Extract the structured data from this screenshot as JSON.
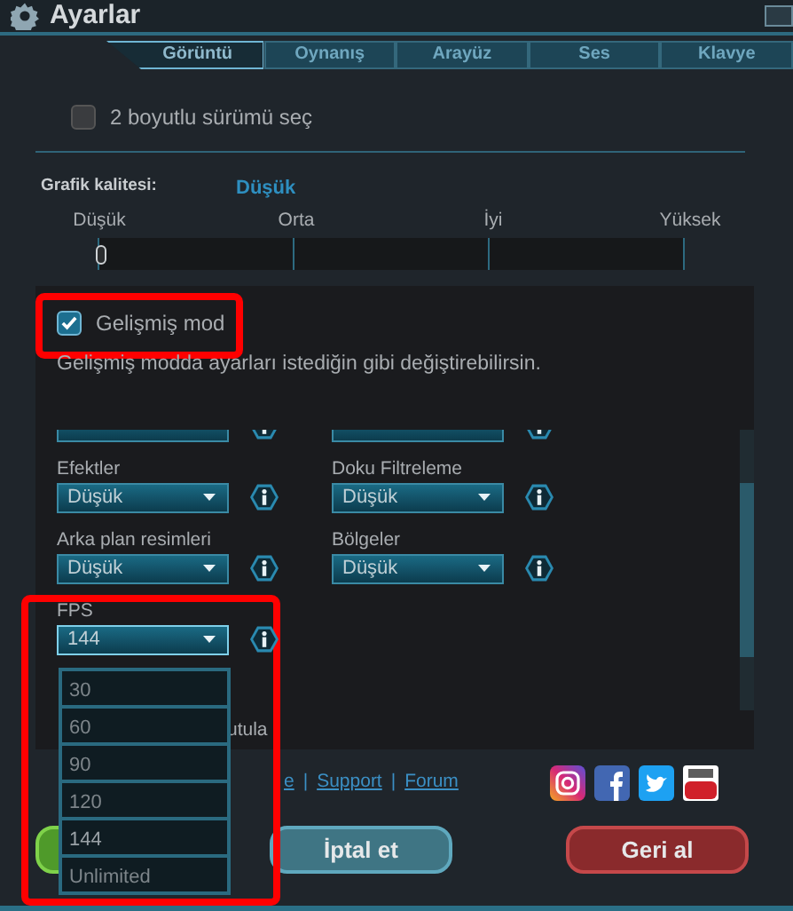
{
  "window": {
    "title": "Ayarlar"
  },
  "tabs": [
    {
      "label": "Görüntü",
      "selected": true
    },
    {
      "label": "Oynanış",
      "selected": false
    },
    {
      "label": "Arayüz",
      "selected": false
    },
    {
      "label": "Ses",
      "selected": false
    },
    {
      "label": "Klavye",
      "selected": false
    }
  ],
  "two_d_version": {
    "label": "2 boyutlu sürümü seç",
    "checked": false
  },
  "graphics_quality": {
    "label": "Grafik kalitesi:",
    "value": "Düşük",
    "ticks": [
      "Düşük",
      "Orta",
      "İyi",
      "Yüksek"
    ],
    "level": 0
  },
  "advanced_mode": {
    "label": "Gelişmiş mod",
    "checked": true,
    "highlighted": true,
    "description": "Gelişmiş modda ayarları istediğin gibi değiştirebilirsin."
  },
  "settings": [
    {
      "label": "Efektler",
      "value": "Düşük",
      "expanded": false
    },
    {
      "label": "Doku Filtreleme",
      "value": "Düşük",
      "expanded": false
    },
    {
      "label": "Arka plan resimleri",
      "value": "Düşük",
      "expanded": false
    },
    {
      "label": "Bölgeler",
      "value": "Düşük",
      "expanded": false
    },
    {
      "label": "FPS",
      "value": "144",
      "expanded": true,
      "highlighted": true,
      "options": [
        "30",
        "60",
        "90",
        "120",
        "144",
        "Unlimited"
      ]
    }
  ],
  "covered_option_label": "utula",
  "links": [
    {
      "label": "e"
    },
    {
      "separator": "|",
      "label": "Support"
    },
    {
      "separator": "|",
      "label": "Forum"
    }
  ],
  "social": [
    {
      "kind": "instagram"
    },
    {
      "kind": "facebook"
    },
    {
      "kind": "twitter"
    },
    {
      "kind": "youtube"
    }
  ],
  "buttons": [
    {
      "kind": "confirm"
    },
    {
      "kind": "cancel",
      "label": "İptal et"
    },
    {
      "kind": "reset",
      "label": "Geri al"
    }
  ]
}
